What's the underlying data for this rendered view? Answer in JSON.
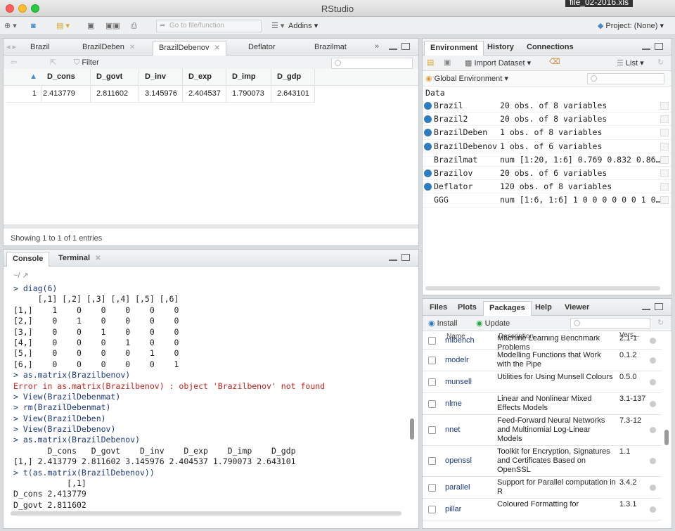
{
  "window": {
    "title": "RStudio",
    "corner_file": "file_02-2016.xls"
  },
  "toolbar": {
    "goto_placeholder": "Go to file/function",
    "addins": "Addins",
    "project": "Project: (None)"
  },
  "source_tabs": [
    "Brazil",
    "BrazilDeben",
    "BrazilDebenov",
    "Deflator",
    "Brazilmat"
  ],
  "viewer": {
    "filter_label": "Filter",
    "columns": [
      "D_cons",
      "D_govt",
      "D_inv",
      "D_exp",
      "D_imp",
      "D_gdp"
    ],
    "rows": [
      {
        "index": "1",
        "values": [
          "2.413779",
          "2.811602",
          "3.145976",
          "2.404537",
          "1.790073",
          "2.643101"
        ]
      }
    ],
    "showing": "Showing 1 to 1 of 1 entries"
  },
  "console": {
    "tabs": [
      "Console",
      "Terminal"
    ],
    "path": "~/",
    "lines": [
      {
        "t": "> diag(6)",
        "k": "prompt"
      },
      {
        "t": "     [,1] [,2] [,3] [,4] [,5] [,6]",
        "k": "out"
      },
      {
        "t": "[1,]    1    0    0    0    0    0",
        "k": "out"
      },
      {
        "t": "[2,]    0    1    0    0    0    0",
        "k": "out"
      },
      {
        "t": "[3,]    0    0    1    0    0    0",
        "k": "out"
      },
      {
        "t": "[4,]    0    0    0    1    0    0",
        "k": "out"
      },
      {
        "t": "[5,]    0    0    0    0    1    0",
        "k": "out"
      },
      {
        "t": "[6,]    0    0    0    0    0    1",
        "k": "out"
      },
      {
        "t": "> as.matrix(Brazilbenov)",
        "k": "prompt"
      },
      {
        "t": "Error in as.matrix(Brazilbenov) : object 'Brazilbenov' not found",
        "k": "err"
      },
      {
        "t": "> View(BrazilDebenmat)",
        "k": "prompt"
      },
      {
        "t": "> rm(BrazilDebenmat)",
        "k": "prompt"
      },
      {
        "t": "> View(BrazilDeben)",
        "k": "prompt"
      },
      {
        "t": "> View(BrazilDebenov)",
        "k": "prompt"
      },
      {
        "t": "> as.matrix(BrazilDebenov)",
        "k": "prompt"
      },
      {
        "t": "       D_cons   D_govt    D_inv    D_exp    D_imp    D_gdp",
        "k": "out"
      },
      {
        "t": "[1,] 2.413779 2.811602 3.145976 2.404537 1.790073 2.643101",
        "k": "out"
      },
      {
        "t": "> t(as.matrix(BrazilDebenov))",
        "k": "prompt"
      },
      {
        "t": "           [,1]",
        "k": "out"
      },
      {
        "t": "D_cons 2.413779",
        "k": "out"
      },
      {
        "t": "D_govt 2.811602",
        "k": "out"
      }
    ]
  },
  "env": {
    "tabs": [
      "Environment",
      "History",
      "Connections"
    ],
    "import_label": "Import Dataset",
    "list_label": "List",
    "scope": "Global Environment",
    "section": "Data",
    "items": [
      {
        "name": "Brazil",
        "value": "20 obs. of 8 variables",
        "dot": true
      },
      {
        "name": "Brazil2",
        "value": "20 obs. of 8 variables",
        "dot": true
      },
      {
        "name": "BrazilDeben",
        "value": "1 obs. of 8 variables",
        "dot": true
      },
      {
        "name": "BrazilDebenov",
        "value": "1 obs. of 6 variables",
        "dot": true
      },
      {
        "name": "Brazilmat",
        "value": "num [1:20, 1:6] 0.769 0.832 0.86…",
        "dot": false
      },
      {
        "name": "Brazilov",
        "value": "20 obs. of 6 variables",
        "dot": true
      },
      {
        "name": "Deflator",
        "value": "120 obs. of 8 variables",
        "dot": true
      },
      {
        "name": "GGG",
        "value": "num [1:6, 1:6] 1 0 0 0 0 0 0 1 0…",
        "dot": false
      }
    ]
  },
  "files": {
    "tabs": [
      "Files",
      "Plots",
      "Packages",
      "Help",
      "Viewer"
    ],
    "install": "Install",
    "update": "Update",
    "headers": {
      "name": "Name",
      "desc": "Description",
      "ver": "Vers..."
    },
    "packages": [
      {
        "name": "mlbench",
        "desc": "Machine Learning Benchmark Problems",
        "ver": "2.1-1"
      },
      {
        "name": "modelr",
        "desc": "Modelling Functions that Work with the Pipe",
        "ver": "0.1.2"
      },
      {
        "name": "munsell",
        "desc": "Utilities for Using Munsell Colours",
        "ver": "0.5.0"
      },
      {
        "name": "nlme",
        "desc": "Linear and Nonlinear Mixed Effects Models",
        "ver": "3.1-137"
      },
      {
        "name": "nnet",
        "desc": "Feed-Forward Neural Networks and Multinomial Log-Linear Models",
        "ver": "7.3-12"
      },
      {
        "name": "openssl",
        "desc": "Toolkit for Encryption, Signatures and Certificates Based on OpenSSL",
        "ver": "1.1"
      },
      {
        "name": "parallel",
        "desc": "Support for Parallel computation in R",
        "ver": "3.4.2"
      },
      {
        "name": "pillar",
        "desc": "Coloured Formatting for",
        "ver": "1.3.1"
      }
    ]
  }
}
